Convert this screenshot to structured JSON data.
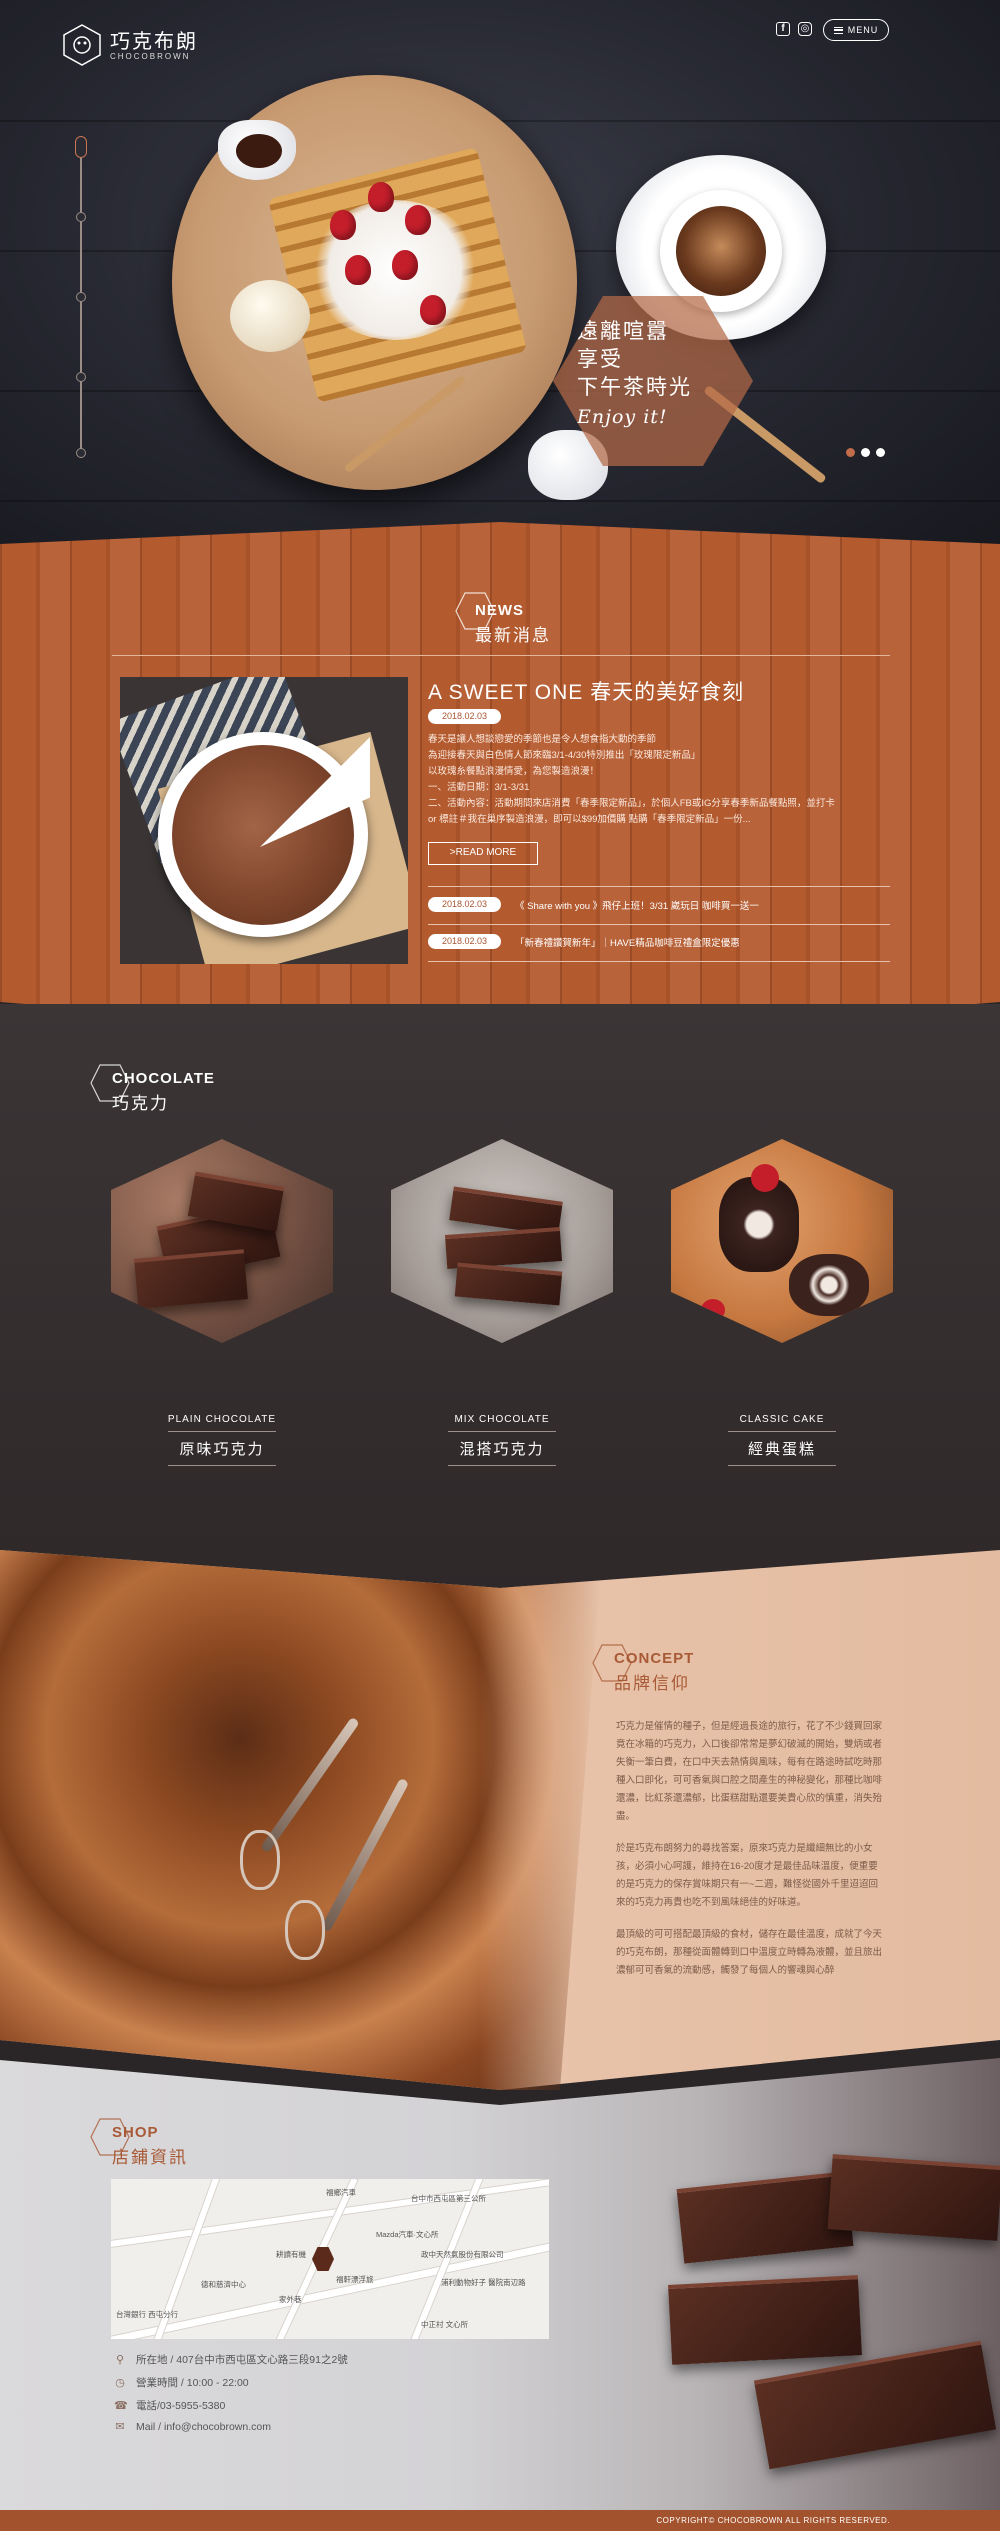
{
  "brand": {
    "name_zh": "巧克布朗",
    "name_en": "CHOCOBROWN"
  },
  "header": {
    "menu_label": "MENU",
    "social": [
      "facebook-icon",
      "instagram-icon"
    ]
  },
  "hero": {
    "tagline": [
      "遠離喧囂",
      "享受",
      "下午茶時光"
    ],
    "tagline_en": "Enjoy it!",
    "slides": 3,
    "active_slide": 1
  },
  "news": {
    "heading_en": "NEWS",
    "heading_zh": "最新消息",
    "feature": {
      "title": "A SWEET ONE 春天的美好食刻",
      "date": "2018.02.03",
      "body": [
        "春天是讓人想談戀愛的季節也是令人想食指大動的季節",
        "為迎接春天與白色情人節來臨3/1-4/30特別推出「玫瑰限定新品」",
        "以玫瑰糸餐點浪漫情愛，為您製造浪漫！",
        "一、活動日期：3/1-3/31",
        "二、活動內容：活動期間來店消費「春季限定新品」，於個人FB或IG分享春季新品餐點照，並打卡",
        "or 標註＃我在巢序製造浪漫，即可以$99加價購 點購「春季限定新品」一份..."
      ],
      "read_more": ">READ MORE"
    },
    "items": [
      {
        "date": "2018.02.03",
        "text": "《 Share with you 》飛仔上班！3/31 崴玩日 咖啡買一送一"
      },
      {
        "date": "2018.02.03",
        "text": "「新春禮讚賀新年」｜HAVE精品咖啡豆禮盒限定優惠"
      }
    ]
  },
  "chocolate": {
    "heading_en": "CHOCOLATE",
    "heading_zh": "巧克力",
    "products": [
      {
        "en": "PLAIN CHOCOLATE",
        "zh": "原味巧克力"
      },
      {
        "en": "MIX CHOCOLATE",
        "zh": "混搭巧克力"
      },
      {
        "en": "CLASSIC CAKE",
        "zh": "經典蛋糕"
      }
    ]
  },
  "concept": {
    "heading_en": "CONCEPT",
    "heading_zh": "品牌信仰",
    "paragraphs": [
      "巧克力是催情的種子，但是經過長途的旅行，花了不少錢買回家竟在冰箱的巧克力，入口後卻常常是夢幻破滅的開始，雙炳或者失衡一筆白費，在口中天去熱情與風味，每有在路途時試吃時那種入口即化，可可香氣與口腔之間產生的神秘變化，那種比咖啡還濃，比紅茶還濃郁，比蛋糕甜點還要美貴心欣的慎重，消失殆盡。",
      "於是巧克布朗努力的尋找答案，原來巧克力是纖細無比的小女孩，必須小心呵護，維持在16-20度才是最佳品味溫度，便重要的是巧克力的保存賞味期只有一~二週，難怪從國外千里迢迢回來的巧克力再貴也吃不到風味絕佳的好味道。",
      "最頂級的可可搭配最頂級的食材，儲存在最佳溫度，成就了今天的巧克布朗，那種從面體轉到口中溫度立時轉為液體，並且旅出濃郁可可香氣的流動感，觸發了每個人的響魂與心醉"
    ]
  },
  "shop": {
    "heading_en": "SHOP",
    "heading_zh": "店鋪資訊",
    "info": [
      {
        "icon": "location-icon",
        "text": "所在地 / 407台中市西屯區文心路三段91之2號"
      },
      {
        "icon": "clock-icon",
        "text": "營業時間 / 10:00 - 22:00"
      },
      {
        "icon": "phone-icon",
        "text": "電話/03-5955-5380"
      },
      {
        "icon": "mail-icon",
        "text": "Mail / info@chocobrown.com"
      }
    ],
    "map_labels": [
      "福鄉汽車",
      "台中市西屯區第三公所",
      "Mazda汽車·文心所",
      "耕讀有機",
      "政中天然氣股份有限公司",
      "德和慈濟中心",
      "家外巷",
      "福軒漂浮旅",
      "台灣銀行 西屯分行",
      "浦利動物好子 醫院南辺路",
      "中正村 文心所"
    ]
  },
  "footer": {
    "copyright": "COPYRIGHT© CHOCOBROWN ALL RIGHTS RESERVED."
  },
  "colors": {
    "accent": "#b35a2e",
    "dark": "#2e2829",
    "concept_bg": "#efcfb7",
    "pill_text": "#a85530"
  }
}
